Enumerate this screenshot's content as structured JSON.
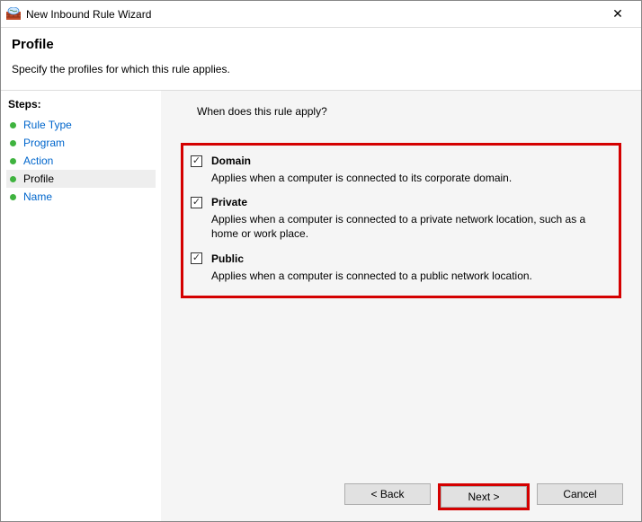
{
  "window": {
    "title": "New Inbound Rule Wizard"
  },
  "header": {
    "title": "Profile",
    "subtitle": "Specify the profiles for which this rule applies."
  },
  "sidebar": {
    "heading": "Steps:",
    "items": [
      {
        "label": "Rule Type",
        "link": true,
        "current": false
      },
      {
        "label": "Program",
        "link": true,
        "current": false
      },
      {
        "label": "Action",
        "link": true,
        "current": false
      },
      {
        "label": "Profile",
        "link": false,
        "current": true
      },
      {
        "label": "Name",
        "link": true,
        "current": false
      }
    ]
  },
  "main": {
    "question": "When does this rule apply?",
    "options": [
      {
        "key": "domain",
        "title": "Domain",
        "checked": true,
        "desc": "Applies when a computer is connected to its corporate domain."
      },
      {
        "key": "private",
        "title": "Private",
        "checked": true,
        "desc": "Applies when a computer is connected to a private network location, such as a home or work place."
      },
      {
        "key": "public",
        "title": "Public",
        "checked": true,
        "desc": "Applies when a computer is connected to a public network location."
      }
    ]
  },
  "buttons": {
    "back": "< Back",
    "next": "Next >",
    "cancel": "Cancel"
  },
  "highlight": {
    "options_box": true,
    "next_button": true
  }
}
